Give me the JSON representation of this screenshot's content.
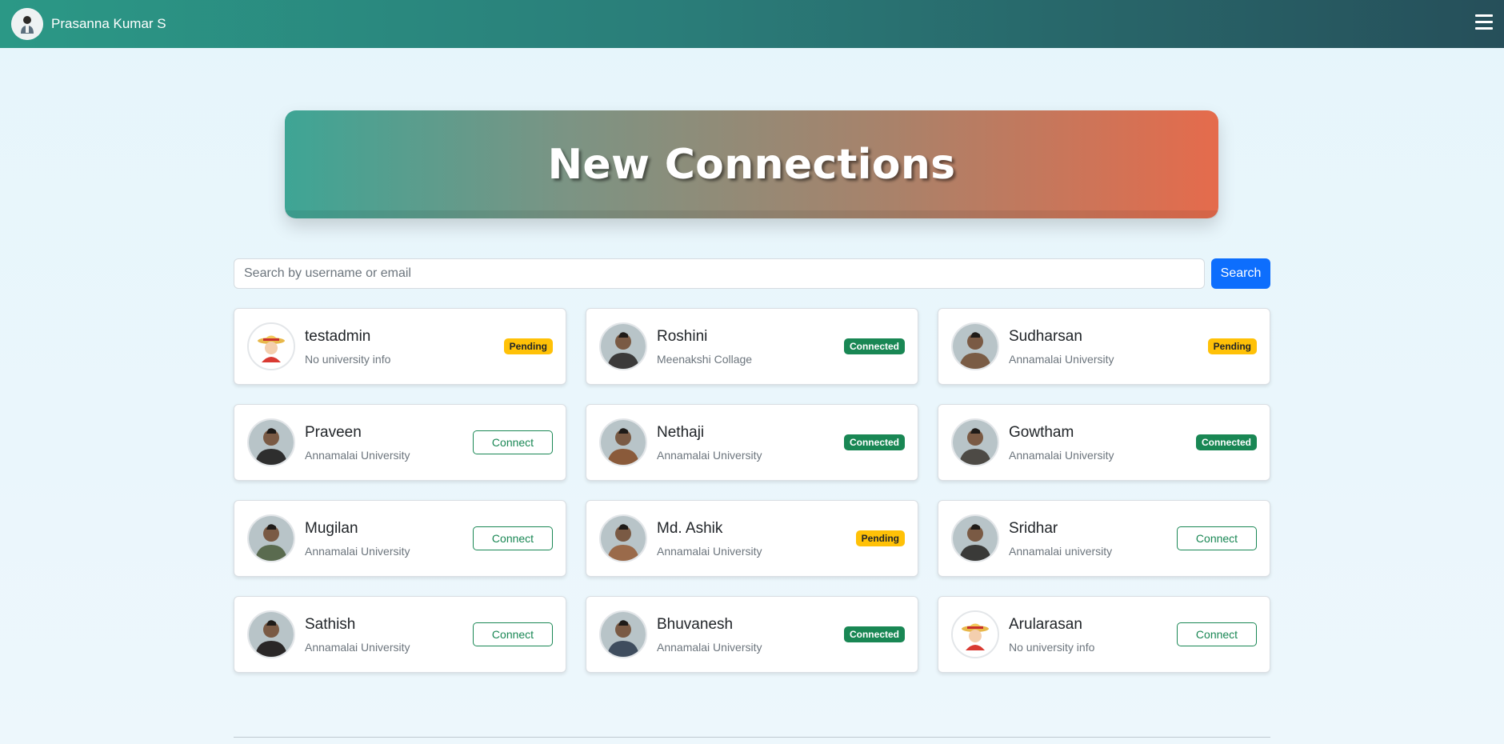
{
  "navbar": {
    "user_name": "Prasanna Kumar S",
    "avatar_icon": "user-avatar",
    "menu_icon": "hamburger-icon"
  },
  "banner": {
    "title": "New Connections"
  },
  "search": {
    "placeholder": "Search by username or email",
    "value": "",
    "button_label": "Search"
  },
  "colors": {
    "navbar_start": "#2b9886",
    "navbar_end": "#264f5a",
    "banner_start": "#3ea595",
    "banner_end": "#e56b4c",
    "pending": "#ffc107",
    "connected": "#198754",
    "primary": "#0d6efd"
  },
  "connections": [
    {
      "name": "testadmin",
      "university": "No university info",
      "status": "pending",
      "status_label": "Pending",
      "avatar": "cartoon-avatar"
    },
    {
      "name": "Roshini",
      "university": "Meenakshi Collage",
      "status": "connected",
      "status_label": "Connected",
      "avatar": "photo-avatar"
    },
    {
      "name": "Sudharsan",
      "university": "Annamalai University",
      "status": "pending",
      "status_label": "Pending",
      "avatar": "photo-avatar"
    },
    {
      "name": "Praveen",
      "university": "Annamalai University",
      "status": "none",
      "status_label": "Connect",
      "avatar": "photo-avatar"
    },
    {
      "name": "Nethaji",
      "university": "Annamalai University",
      "status": "connected",
      "status_label": "Connected",
      "avatar": "photo-avatar"
    },
    {
      "name": "Gowtham",
      "university": "Annamalai University",
      "status": "connected",
      "status_label": "Connected",
      "avatar": "photo-avatar"
    },
    {
      "name": "Mugilan",
      "university": "Annamalai University",
      "status": "none",
      "status_label": "Connect",
      "avatar": "photo-avatar"
    },
    {
      "name": "Md. Ashik",
      "university": "Annamalai University",
      "status": "pending",
      "status_label": "Pending",
      "avatar": "photo-avatar"
    },
    {
      "name": "Sridhar",
      "university": "Annamalai university",
      "status": "none",
      "status_label": "Connect",
      "avatar": "photo-avatar"
    },
    {
      "name": "Sathish",
      "university": "Annamalai University",
      "status": "none",
      "status_label": "Connect",
      "avatar": "photo-avatar"
    },
    {
      "name": "Bhuvanesh",
      "university": "Annamalai University",
      "status": "connected",
      "status_label": "Connected",
      "avatar": "photo-avatar"
    },
    {
      "name": "Arularasan",
      "university": "No university info",
      "status": "none",
      "status_label": "Connect",
      "avatar": "cartoon-avatar"
    }
  ]
}
